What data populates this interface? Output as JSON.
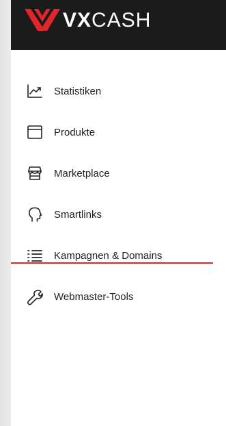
{
  "brand": {
    "name_bold": "VX",
    "name_regular": "CASH",
    "accent_color": "#e0262b"
  },
  "nav": {
    "items": [
      {
        "label": "Statistiken",
        "icon": "trending-chart-icon"
      },
      {
        "label": "Produkte",
        "icon": "browser-window-icon"
      },
      {
        "label": "Marketplace",
        "icon": "storefront-icon"
      },
      {
        "label": "Smartlinks",
        "icon": "head-profile-icon"
      },
      {
        "label": "Kampagnen & Domains",
        "icon": "list-icon",
        "active": true
      },
      {
        "label": "Webmaster-Tools",
        "icon": "wrench-icon"
      }
    ]
  }
}
